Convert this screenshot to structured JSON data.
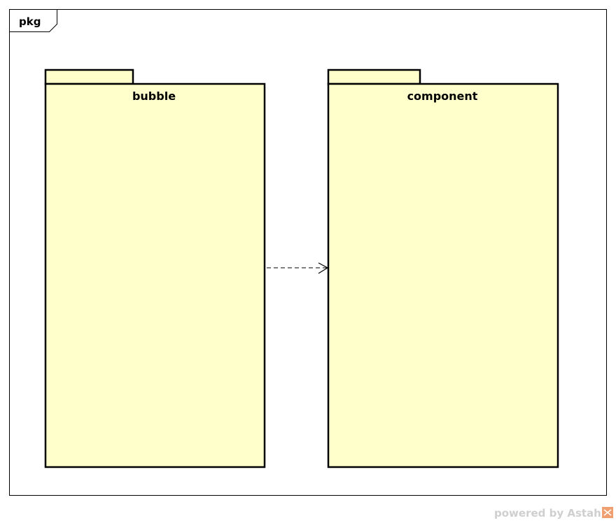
{
  "frame": {
    "label": "pkg"
  },
  "packages": [
    {
      "name": "bubble"
    },
    {
      "name": "component"
    }
  ],
  "dependency": {
    "from": "bubble",
    "to": "component",
    "style": "dashed-open-arrow"
  },
  "colors": {
    "package_fill": "#ffffcc",
    "stroke": "#000000",
    "watermark": "#cfcfcf",
    "watermark_logo": "#f0a070"
  },
  "watermark": {
    "text": "powered by Astah",
    "logo_icon": "astah-logo-icon"
  }
}
